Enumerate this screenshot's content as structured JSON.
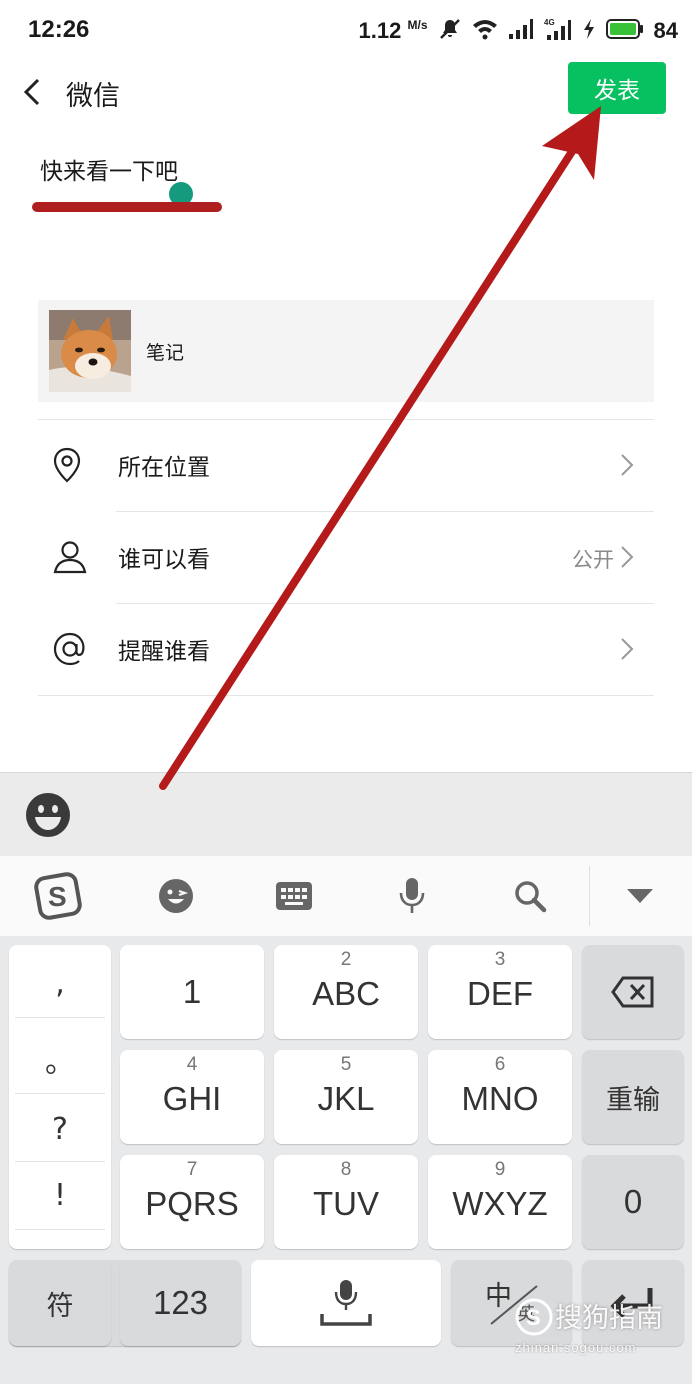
{
  "status_bar": {
    "time": "12:26",
    "speed": "1.12",
    "speed_unit": "M/s",
    "battery": "84"
  },
  "header": {
    "title": "微信",
    "publish_label": "发表",
    "publish_color": "#07c160"
  },
  "composer": {
    "post_text": "快来看一下吧",
    "link_card_label": "笔记"
  },
  "menu": {
    "location_label": "所在位置",
    "visibility_label": "谁可以看",
    "visibility_value": "公开",
    "mention_label": "提醒谁看"
  },
  "keyboard": {
    "punctuation": [
      ",",
      "。",
      "?",
      "!"
    ],
    "row1": [
      {
        "num": "",
        "letters": "1"
      },
      {
        "num": "2",
        "letters": "ABC"
      },
      {
        "num": "3",
        "letters": "DEF"
      }
    ],
    "row2": [
      {
        "num": "4",
        "letters": "GHI"
      },
      {
        "num": "5",
        "letters": "JKL"
      },
      {
        "num": "6",
        "letters": "MNO"
      }
    ],
    "row3": [
      {
        "num": "7",
        "letters": "PQRS"
      },
      {
        "num": "8",
        "letters": "TUV"
      },
      {
        "num": "9",
        "letters": "WXYZ"
      }
    ],
    "reenter_label": "重输",
    "zero_label": "0",
    "symbol_label": "符",
    "numeric_label": "123",
    "lang_label": "中",
    "lang_sub_label": "英"
  },
  "watermark": {
    "main": "搜狗指南",
    "sub": "zhinan.sogou.com"
  },
  "annotation_color": "#b51a1a"
}
